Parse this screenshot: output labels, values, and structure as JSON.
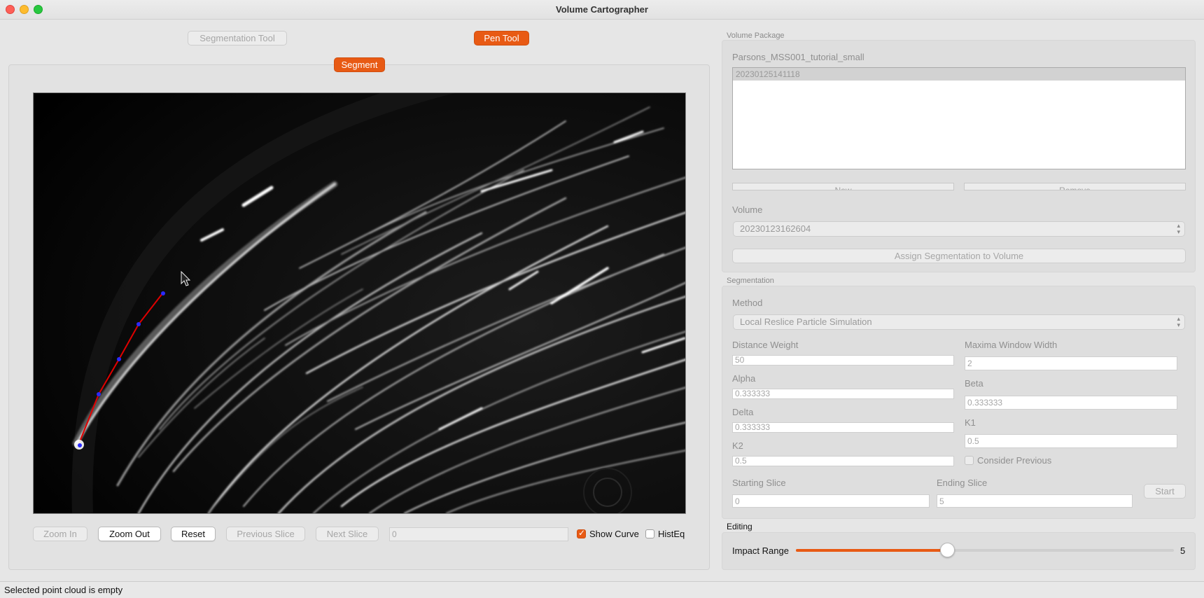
{
  "window": {
    "title": "Volume Cartographer"
  },
  "tools": {
    "segmentation_tool": "Segmentation Tool",
    "pen_tool": "Pen Tool",
    "segment": "Segment"
  },
  "viewer_controls": {
    "zoom_in": "Zoom In",
    "zoom_out": "Zoom Out",
    "reset": "Reset",
    "previous_slice": "Previous Slice",
    "next_slice": "Next Slice",
    "slice_value": "0",
    "show_curve": {
      "label": "Show Curve",
      "checked": true
    },
    "histeq": {
      "label": "HistEq",
      "checked": false
    }
  },
  "volume_package": {
    "group_label": "Volume Package",
    "name": "Parsons_MSS001_tutorial_small",
    "segmentations": [
      "20230125141118"
    ],
    "new_button": "New",
    "remove_button": "Remove",
    "volume_label": "Volume",
    "volume_selected": "20230123162604",
    "assign_button": "Assign Segmentation to Volume"
  },
  "segmentation": {
    "group_label": "Segmentation",
    "method_label": "Method",
    "method_selected": "Local Reslice Particle Simulation",
    "distance_weight_label": "Distance Weight",
    "distance_weight": "50",
    "maxima_window_width_label": "Maxima Window Width",
    "maxima_window_width": "2",
    "alpha_label": "Alpha",
    "alpha": "0.333333",
    "beta_label": "Beta",
    "beta": "0.333333",
    "delta_label": "Delta",
    "delta": "0.333333",
    "k1_label": "K1",
    "k1": "0.5",
    "k2_label": "K2",
    "k2": "0.5",
    "consider_previous": {
      "label": "Consider Previous",
      "checked": false
    },
    "starting_slice_label": "Starting Slice",
    "starting_slice": "0",
    "ending_slice_label": "Ending Slice",
    "ending_slice": "5",
    "start_button": "Start"
  },
  "editing": {
    "group_label": "Editing",
    "impact_range_label": "Impact Range",
    "impact_range_value": "5",
    "impact_range_fraction": 0.4,
    "accent_color": "#e85a14"
  },
  "status": {
    "message": "Selected point cloud is empty"
  }
}
